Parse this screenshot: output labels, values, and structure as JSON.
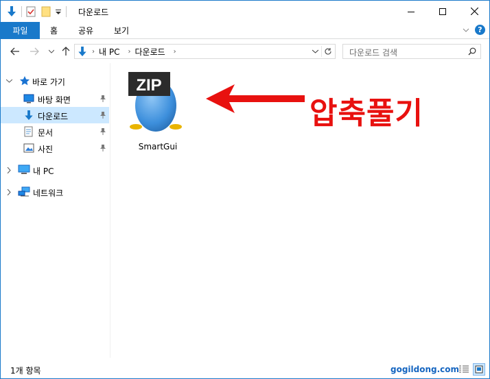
{
  "window": {
    "title": "다운로드",
    "accent": "#1979ca"
  },
  "quick_access_toolbar": {
    "icons": [
      "download-arrow-icon",
      "properties-icon",
      "new-folder-icon",
      "qat-dropdown-icon"
    ]
  },
  "window_controls": {
    "minimize": "minimize-icon",
    "maximize": "maximize-icon",
    "close": "close-icon"
  },
  "ribbon": {
    "tabs": [
      {
        "label": "파일"
      },
      {
        "label": "홈"
      },
      {
        "label": "공유"
      },
      {
        "label": "보기"
      }
    ]
  },
  "navbar": {
    "address_parts": [
      "내 PC",
      "다운로드"
    ]
  },
  "search": {
    "placeholder": "다운로드 검색"
  },
  "navpane": {
    "quick_access": "바로 가기",
    "items": [
      {
        "label": "바탕 화면",
        "icon": "desktop-icon",
        "pinned": true
      },
      {
        "label": "다운로드",
        "icon": "downloads-icon",
        "pinned": true
      },
      {
        "label": "문서",
        "icon": "documents-icon",
        "pinned": true
      },
      {
        "label": "사진",
        "icon": "pictures-icon",
        "pinned": true
      }
    ],
    "this_pc": "내 PC",
    "network": "네트워크"
  },
  "content": {
    "files": [
      {
        "name": "SmartGui",
        "badge": "ZIP",
        "icon": "zip-archive-icon"
      }
    ],
    "annotation": "압축풀기",
    "annotation_color": "#e8110f"
  },
  "statusbar": {
    "item_count": "1개 항목",
    "watermark": "gogildong.com"
  }
}
